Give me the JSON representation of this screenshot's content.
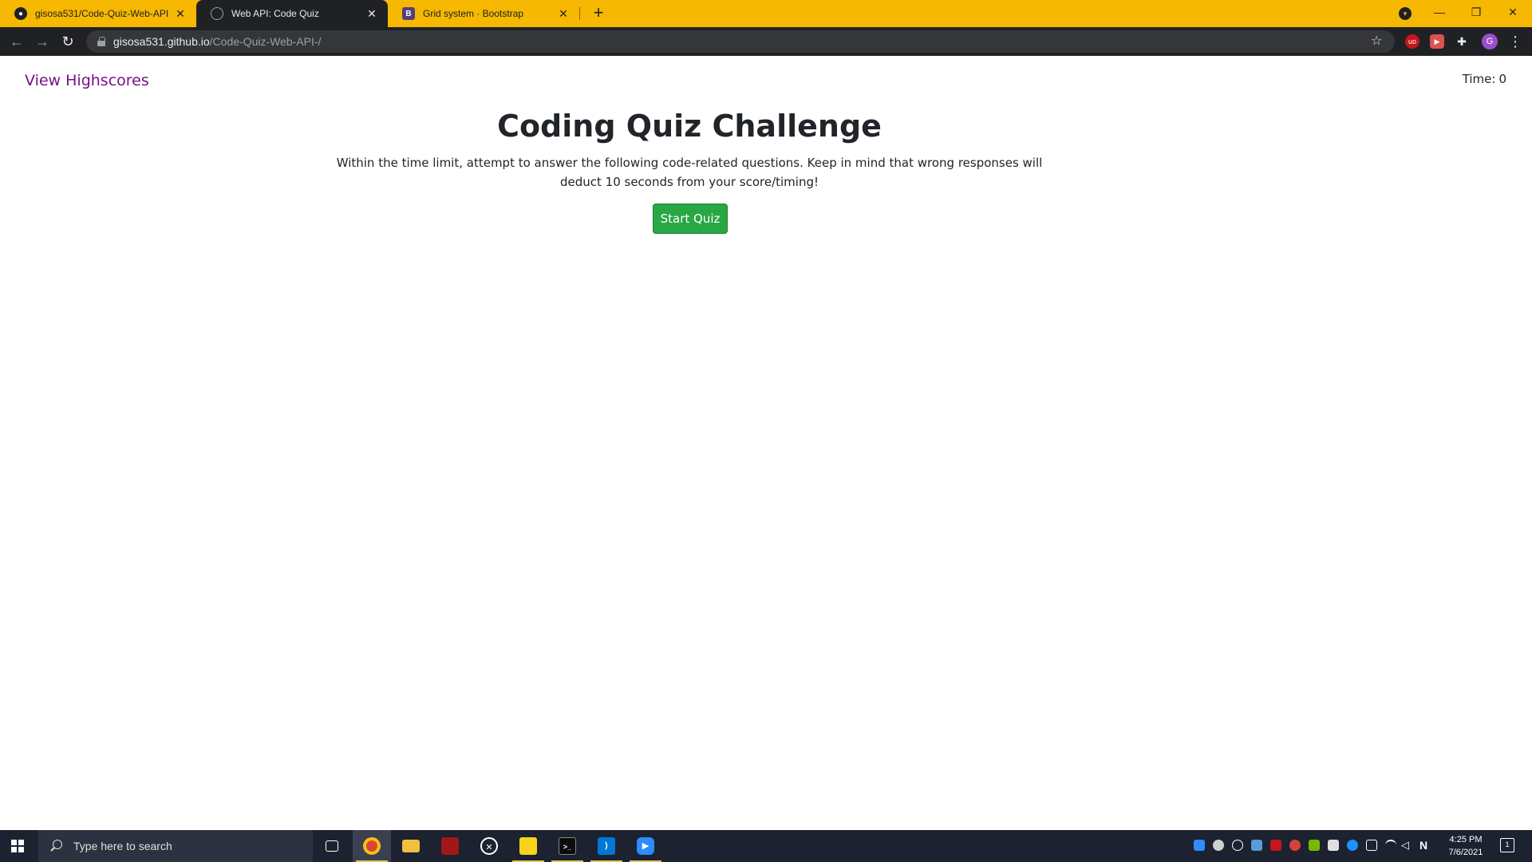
{
  "browser": {
    "tabs": [
      {
        "title": "gisosa531/Code-Quiz-Web-API-",
        "icon": "github-icon",
        "active": false
      },
      {
        "title": "Web API: Code Quiz",
        "icon": "globe-icon",
        "active": true
      },
      {
        "title": "Grid system · Bootstrap",
        "icon": "bootstrap-icon",
        "active": false
      }
    ],
    "tab_close_glyph": "✕",
    "new_tab_glyph": "+",
    "url_host": "gisosa531.github.io",
    "url_path": "/Code-Quiz-Web-API-/",
    "avatar_letter": "G",
    "accent_color": "#f6b800"
  },
  "page": {
    "highscores_link": "View Highscores",
    "timer_label": "Time:",
    "timer_value": "0",
    "title": "Coding Quiz Challenge",
    "description": "Within the time limit, attempt to answer the following code-related questions. Keep in mind that wrong responses will deduct 10 seconds from your score/timing!",
    "start_button": "Start Quiz"
  },
  "taskbar": {
    "search_placeholder": "Type here to search",
    "time": "4:25 PM",
    "date": "7/6/2021",
    "notification_count": "1"
  }
}
